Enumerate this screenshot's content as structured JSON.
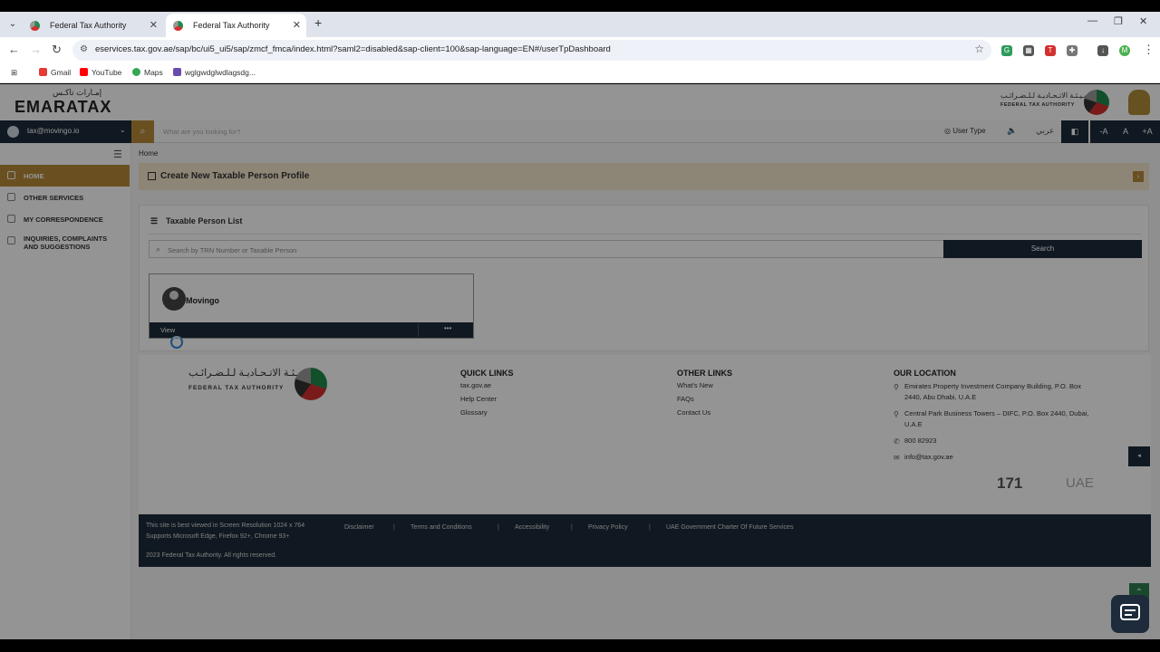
{
  "browser": {
    "tabs": [
      {
        "title": "Federal Tax Authority"
      },
      {
        "title": "Federal Tax Authority"
      }
    ],
    "url": "eservices.tax.gov.ae/sap/bc/ui5_ui5/sap/zmcf_fmca/index.html?saml2=disabled&sap-client=100&sap-language=EN#/userTpDashboard",
    "bookmarks": [
      "Gmail",
      "YouTube",
      "Maps",
      "wglgwdglwdlagsdg..."
    ],
    "profile_initial": "M"
  },
  "header": {
    "logo": "EMARATAX",
    "logo_ar": "إمـارات تاكـس",
    "fta_ar": "الـهـيـئـة الاتـحـاديـة لـلـضـرائـب",
    "fta_en": "FEDERAL TAX AUTHORITY"
  },
  "toolbar": {
    "user_email": "tax@movingo.io",
    "search_placeholder": "What are you looking for?",
    "user_type": "User Type",
    "arabic": "عربي",
    "font_minus": "-A",
    "font_normal": "A",
    "font_plus": "+A"
  },
  "sidebar": {
    "items": [
      {
        "label": "HOME"
      },
      {
        "label": "OTHER SERVICES"
      },
      {
        "label": "MY CORRESPONDENCE"
      },
      {
        "label": "INQUIRIES, COMPLAINTS AND SUGGESTIONS"
      }
    ]
  },
  "main": {
    "breadcrumb": "Home",
    "create_title": "Create New Taxable Person Profile",
    "list_title": "Taxable Person List",
    "search_placeholder": "Search by TRN Number or Taxable Person",
    "search_button": "Search",
    "card": {
      "name": "Movingo",
      "view": "View",
      "more": "•••"
    }
  },
  "footer": {
    "fta_ar": "الـهـيـئـة الاتـحـاديـة لـلـضـرائـب",
    "fta_en": "FEDERAL TAX AUTHORITY",
    "quick_links": {
      "title": "QUICK LINKS",
      "items": [
        "tax.gov.ae",
        "Help Center",
        "Glossary"
      ]
    },
    "other_links": {
      "title": "OTHER LINKS",
      "items": [
        "What's New",
        "FAQs",
        "Contact Us"
      ]
    },
    "location": {
      "title": "OUR LOCATION",
      "addr1": "Emirates Property Investment Company Building, P.O. Box 2440, Abu Dhabi, U.A.E",
      "addr2": "Central Park Business Towers – DIFC, P.O. Box 2440, Dubai, U.A.E",
      "phone": "800 82923",
      "email": "info@tax.gov.ae"
    },
    "badge": "171",
    "uae": "UAE"
  },
  "bottom": {
    "note1": "This site is best viewed in Screen Resolution 1024 x 764",
    "note2": "Supports Microsoft Edge, Firefox 92+, Chrome 93+",
    "copyright": "2023 Federal Tax Authority. All rights reserved.",
    "links": [
      "Disclaimer",
      "Terms and Conditions",
      "Accessibility",
      "Privacy Policy",
      "UAE Government Charter Of Future Services"
    ]
  }
}
